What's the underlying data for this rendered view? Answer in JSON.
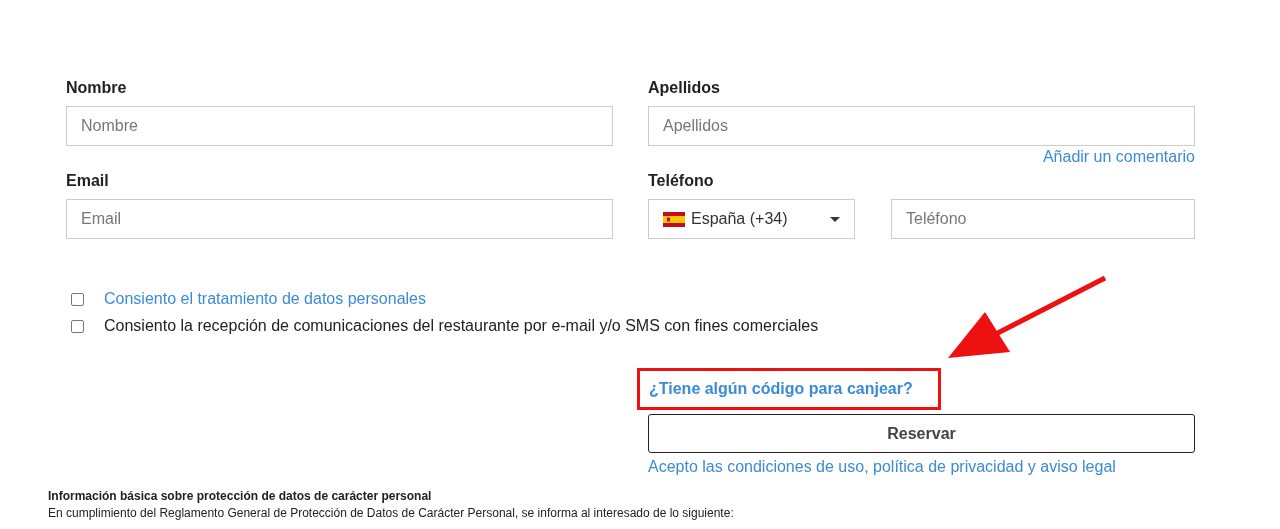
{
  "fields": [
    {
      "label": "Nombre",
      "placeholder": "Nombre"
    },
    {
      "label": "Apellidos",
      "placeholder": "Apellidos"
    }
  ],
  "comment_link": "Añadir un comentario",
  "contact": [
    {
      "label": "Email",
      "placeholder": "Email"
    },
    {
      "label": "Teléfono",
      "country": "España (+34)",
      "placeholder": "Teléfono"
    }
  ],
  "consents": [
    {
      "kind": "link",
      "text": "Consiento el tratamiento de datos personales",
      "checked": false
    },
    {
      "kind": "text",
      "text": "Consiento la recepción de comunicaciones del restaurante por e-mail y/o SMS con fines comerciales",
      "checked": false
    }
  ],
  "code_link": "¿Tiene algún código para canjear?",
  "submit_button": "Reservar",
  "terms_link": "Acepto las condiciones de uso, política de privacidad y aviso legal",
  "info": {
    "title": "Información básica sobre protección de datos de carácter personal",
    "text": "En cumplimiento del Reglamento General de Protección de Datos de Carácter Personal, se informa al interesado de lo siguiente:"
  }
}
